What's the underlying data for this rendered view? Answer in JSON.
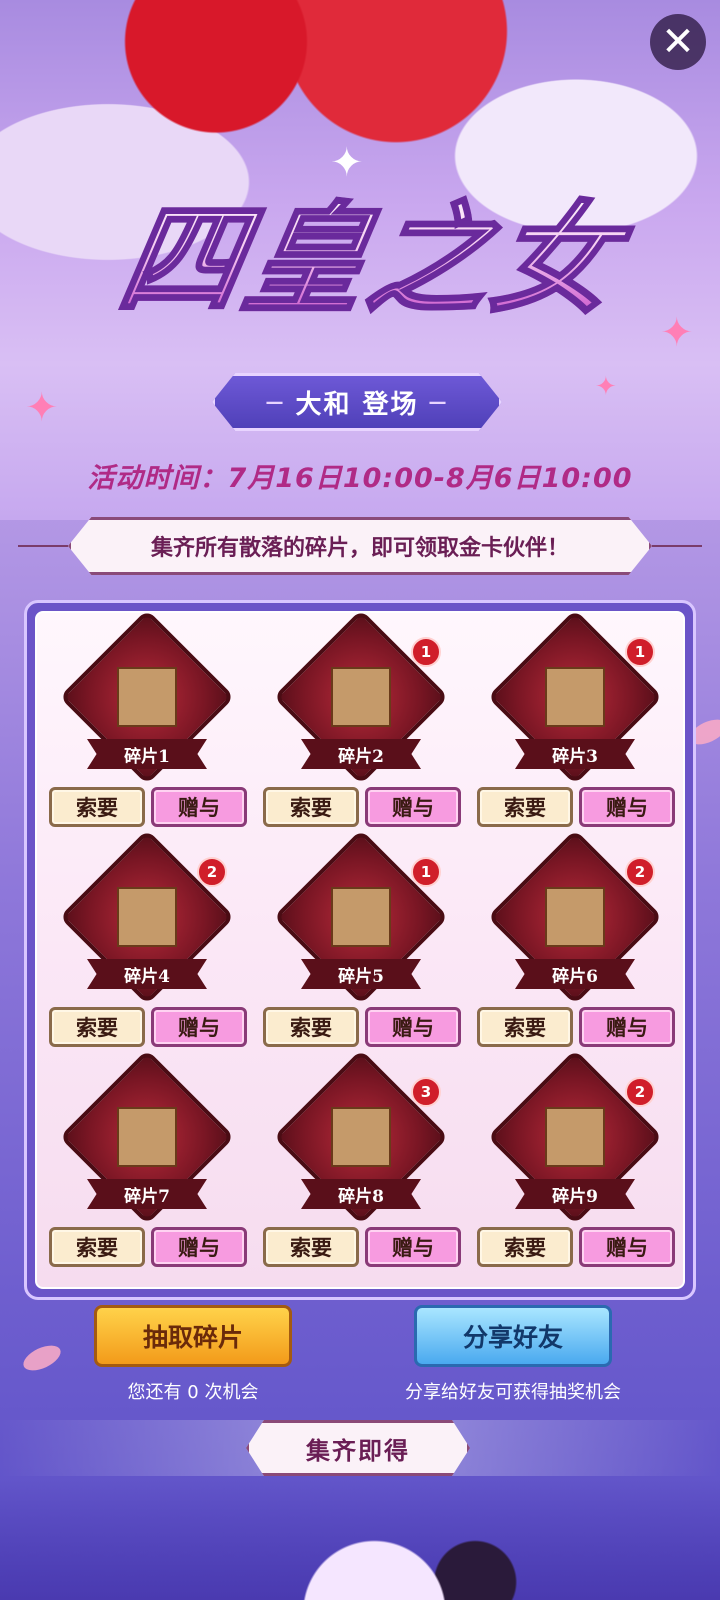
{
  "header": {
    "close_label": "✕",
    "title": "四皇之女",
    "subtitle_left": "—",
    "subtitle": "大和 登场",
    "subtitle_right": "—",
    "event_time": "活动时间：7月16日10:00-8月6日10:00",
    "notice": "集齐所有散落的碎片，即可领取金卡伙伴！"
  },
  "pieces": [
    {
      "label": "碎片1",
      "badge": "",
      "ask": "索要",
      "give": "赠与"
    },
    {
      "label": "碎片2",
      "badge": "1",
      "ask": "索要",
      "give": "赠与"
    },
    {
      "label": "碎片3",
      "badge": "1",
      "ask": "索要",
      "give": "赠与"
    },
    {
      "label": "碎片4",
      "badge": "2",
      "ask": "索要",
      "give": "赠与"
    },
    {
      "label": "碎片5",
      "badge": "1",
      "ask": "索要",
      "give": "赠与"
    },
    {
      "label": "碎片6",
      "badge": "2",
      "ask": "索要",
      "give": "赠与"
    },
    {
      "label": "碎片7",
      "badge": "",
      "ask": "索要",
      "give": "赠与"
    },
    {
      "label": "碎片8",
      "badge": "3",
      "ask": "索要",
      "give": "赠与"
    },
    {
      "label": "碎片9",
      "badge": "2",
      "ask": "索要",
      "give": "赠与"
    }
  ],
  "actions": {
    "draw_label": "抽取碎片",
    "draw_hint": "您还有 0 次机会",
    "share_label": "分享好友",
    "share_hint": "分享给好友可获得抽奖机会"
  },
  "collect": {
    "label": "集齐即得"
  },
  "colors": {
    "accent": "#6b54c8",
    "badge": "#d01e2a",
    "draw": "#f39b1a",
    "share": "#4aa9ef"
  }
}
